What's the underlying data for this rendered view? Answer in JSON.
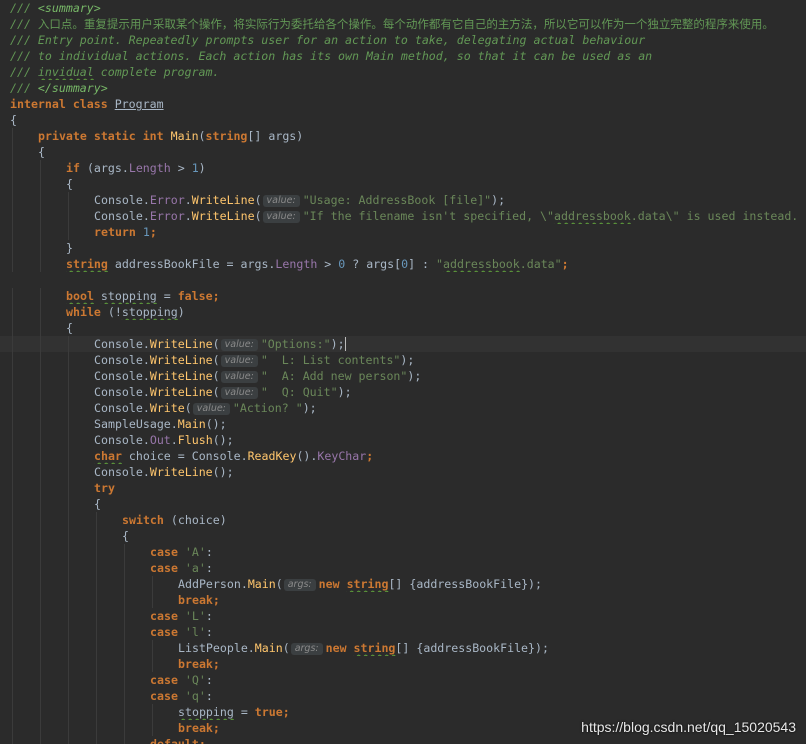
{
  "editor": {
    "lines": [
      {
        "indent": 0,
        "tokens": [
          {
            "c": "doc",
            "t": "/// "
          },
          {
            "c": "doc-tag",
            "t": "<summary>"
          }
        ]
      },
      {
        "indent": 0,
        "tokens": [
          {
            "c": "doc",
            "t": "/// "
          },
          {
            "c": "doc cjk",
            "t": "入口点。重复提示用户采取某个操作，将实际行为委托给各个操作。每个动作都有它自己的主方法，所以它可以作为一个独立完整的程序来使用。"
          }
        ]
      },
      {
        "indent": 0,
        "tokens": [
          {
            "c": "doc",
            "t": "/// Entry point. Repeatedly prompts user for an action to take, delegating actual behaviour"
          }
        ]
      },
      {
        "indent": 0,
        "tokens": [
          {
            "c": "doc",
            "t": "/// to individual actions. Each action has its own Main method, so that it can be used as an"
          }
        ]
      },
      {
        "indent": 0,
        "tokens": [
          {
            "c": "doc",
            "t": "/// "
          },
          {
            "c": "doc squig",
            "t": "invidual"
          },
          {
            "c": "doc",
            "t": " complete program."
          }
        ]
      },
      {
        "indent": 0,
        "tokens": [
          {
            "c": "doc",
            "t": "/// "
          },
          {
            "c": "doc-tag",
            "t": "</summary>"
          }
        ]
      },
      {
        "indent": 0,
        "tokens": [
          {
            "c": "kw",
            "t": "internal class "
          },
          {
            "c": "cls",
            "t": "Program"
          }
        ]
      },
      {
        "indent": 0,
        "tokens": [
          {
            "c": "p",
            "t": "{"
          }
        ]
      },
      {
        "indent": 1,
        "tokens": [
          {
            "c": "kw",
            "t": "private static int "
          },
          {
            "c": "fn",
            "t": "Main"
          },
          {
            "c": "p",
            "t": "("
          },
          {
            "c": "typ",
            "t": "string"
          },
          {
            "c": "p",
            "t": "[] args)"
          }
        ]
      },
      {
        "indent": 1,
        "tokens": [
          {
            "c": "p",
            "t": "{"
          }
        ]
      },
      {
        "indent": 2,
        "tokens": [
          {
            "c": "kw",
            "t": "if "
          },
          {
            "c": "p",
            "t": "(args."
          },
          {
            "c": "mem",
            "t": "Length"
          },
          {
            "c": "p",
            "t": " > "
          },
          {
            "c": "num",
            "t": "1"
          },
          {
            "c": "p",
            "t": ")"
          }
        ]
      },
      {
        "indent": 2,
        "tokens": [
          {
            "c": "p",
            "t": "{"
          }
        ]
      },
      {
        "indent": 3,
        "tokens": [
          {
            "c": "p",
            "t": "Console."
          },
          {
            "c": "mem",
            "t": "Error"
          },
          {
            "c": "p",
            "t": "."
          },
          {
            "c": "fn",
            "t": "WriteLine"
          },
          {
            "c": "p",
            "t": "("
          },
          {
            "c": "hint",
            "t": "value:"
          },
          {
            "c": "str",
            "t": "\"Usage: AddressBook [file]\""
          },
          {
            "c": "p",
            "t": ");"
          }
        ]
      },
      {
        "indent": 3,
        "tokens": [
          {
            "c": "p",
            "t": "Console."
          },
          {
            "c": "mem",
            "t": "Error"
          },
          {
            "c": "p",
            "t": "."
          },
          {
            "c": "fn",
            "t": "WriteLine"
          },
          {
            "c": "p",
            "t": "("
          },
          {
            "c": "hint",
            "t": "value:"
          },
          {
            "c": "str",
            "t": "\"If the filename isn't specified, \\\""
          },
          {
            "c": "str squig",
            "t": "addressbook"
          },
          {
            "c": "str",
            "t": ".data\\\" is used instead."
          }
        ]
      },
      {
        "indent": 3,
        "tokens": [
          {
            "c": "kw",
            "t": "return "
          },
          {
            "c": "num",
            "t": "1"
          },
          {
            "c": "kw",
            "t": ";"
          }
        ]
      },
      {
        "indent": 2,
        "tokens": [
          {
            "c": "p",
            "t": "}"
          }
        ]
      },
      {
        "indent": 2,
        "tokens": [
          {
            "c": "typ squig",
            "t": "string"
          },
          {
            "c": "p",
            "t": " addressBookFile = args."
          },
          {
            "c": "mem",
            "t": "Length"
          },
          {
            "c": "p",
            "t": " > "
          },
          {
            "c": "num",
            "t": "0"
          },
          {
            "c": "p",
            "t": " ? args["
          },
          {
            "c": "num",
            "t": "0"
          },
          {
            "c": "p",
            "t": "] : "
          },
          {
            "c": "str",
            "t": "\""
          },
          {
            "c": "str squig",
            "t": "addressbook"
          },
          {
            "c": "str",
            "t": ".data\""
          },
          {
            "c": "kw",
            "t": ";"
          }
        ]
      },
      {
        "indent": 0,
        "tokens": []
      },
      {
        "indent": 2,
        "tokens": [
          {
            "c": "typ squig",
            "t": "bool"
          },
          {
            "c": "p",
            "t": " "
          },
          {
            "c": "p squig",
            "t": "stopping"
          },
          {
            "c": "p",
            "t": " = "
          },
          {
            "c": "kw",
            "t": "false;"
          }
        ]
      },
      {
        "indent": 2,
        "tokens": [
          {
            "c": "kw",
            "t": "while "
          },
          {
            "c": "p",
            "t": "(!"
          },
          {
            "c": "p squig",
            "t": "stopping"
          },
          {
            "c": "p",
            "t": ")"
          }
        ]
      },
      {
        "indent": 2,
        "tokens": [
          {
            "c": "p",
            "t": "{"
          }
        ]
      },
      {
        "indent": 3,
        "current": true,
        "tokens": [
          {
            "c": "p",
            "t": "Console."
          },
          {
            "c": "fn",
            "t": "WriteLine"
          },
          {
            "c": "p",
            "t": "("
          },
          {
            "c": "hint",
            "t": "value:"
          },
          {
            "c": "str",
            "t": "\"Options:\""
          },
          {
            "c": "p",
            "t": ");"
          },
          {
            "c": "caret",
            "t": ""
          }
        ]
      },
      {
        "indent": 3,
        "tokens": [
          {
            "c": "p",
            "t": "Console."
          },
          {
            "c": "fn",
            "t": "WriteLine"
          },
          {
            "c": "p",
            "t": "("
          },
          {
            "c": "hint",
            "t": "value:"
          },
          {
            "c": "str",
            "t": "\"  L: List contents\""
          },
          {
            "c": "p",
            "t": ");"
          }
        ]
      },
      {
        "indent": 3,
        "tokens": [
          {
            "c": "p",
            "t": "Console."
          },
          {
            "c": "fn",
            "t": "WriteLine"
          },
          {
            "c": "p",
            "t": "("
          },
          {
            "c": "hint",
            "t": "value:"
          },
          {
            "c": "str",
            "t": "\"  A: Add new person\""
          },
          {
            "c": "p",
            "t": ");"
          }
        ]
      },
      {
        "indent": 3,
        "tokens": [
          {
            "c": "p",
            "t": "Console."
          },
          {
            "c": "fn",
            "t": "WriteLine"
          },
          {
            "c": "p",
            "t": "("
          },
          {
            "c": "hint",
            "t": "value:"
          },
          {
            "c": "str",
            "t": "\"  Q: Quit\""
          },
          {
            "c": "p",
            "t": ");"
          }
        ]
      },
      {
        "indent": 3,
        "tokens": [
          {
            "c": "p",
            "t": "Console."
          },
          {
            "c": "fn",
            "t": "Write"
          },
          {
            "c": "p",
            "t": "("
          },
          {
            "c": "hint",
            "t": "value:"
          },
          {
            "c": "str",
            "t": "\"Action? \""
          },
          {
            "c": "p",
            "t": ");"
          }
        ]
      },
      {
        "indent": 3,
        "tokens": [
          {
            "c": "p",
            "t": "SampleUsage."
          },
          {
            "c": "fn",
            "t": "Main"
          },
          {
            "c": "p",
            "t": "();"
          }
        ]
      },
      {
        "indent": 3,
        "tokens": [
          {
            "c": "p",
            "t": "Console."
          },
          {
            "c": "mem",
            "t": "Out"
          },
          {
            "c": "p",
            "t": "."
          },
          {
            "c": "fn",
            "t": "Flush"
          },
          {
            "c": "p",
            "t": "();"
          }
        ]
      },
      {
        "indent": 3,
        "tokens": [
          {
            "c": "typ squig",
            "t": "char"
          },
          {
            "c": "p",
            "t": " choice = Console."
          },
          {
            "c": "fn",
            "t": "ReadKey"
          },
          {
            "c": "p",
            "t": "()."
          },
          {
            "c": "mem",
            "t": "KeyChar"
          },
          {
            "c": "kw",
            "t": ";"
          }
        ]
      },
      {
        "indent": 3,
        "tokens": [
          {
            "c": "p",
            "t": "Console."
          },
          {
            "c": "fn",
            "t": "WriteLine"
          },
          {
            "c": "p",
            "t": "();"
          }
        ]
      },
      {
        "indent": 3,
        "tokens": [
          {
            "c": "kw",
            "t": "try"
          }
        ]
      },
      {
        "indent": 3,
        "tokens": [
          {
            "c": "p",
            "t": "{"
          }
        ]
      },
      {
        "indent": 4,
        "tokens": [
          {
            "c": "kw",
            "t": "switch "
          },
          {
            "c": "p",
            "t": "(choice)"
          }
        ]
      },
      {
        "indent": 4,
        "tokens": [
          {
            "c": "p",
            "t": "{"
          }
        ]
      },
      {
        "indent": 5,
        "tokens": [
          {
            "c": "kw",
            "t": "case "
          },
          {
            "c": "str",
            "t": "'A'"
          },
          {
            "c": "p",
            "t": ":"
          }
        ]
      },
      {
        "indent": 5,
        "tokens": [
          {
            "c": "kw",
            "t": "case "
          },
          {
            "c": "str",
            "t": "'a'"
          },
          {
            "c": "p",
            "t": ":"
          }
        ]
      },
      {
        "indent": 6,
        "tokens": [
          {
            "c": "p",
            "t": "AddPerson."
          },
          {
            "c": "fn",
            "t": "Main"
          },
          {
            "c": "p",
            "t": "("
          },
          {
            "c": "hint",
            "t": "args:"
          },
          {
            "c": "kw",
            "t": "new "
          },
          {
            "c": "typ squig",
            "t": "string"
          },
          {
            "c": "p",
            "t": "[] {addressBookFile});"
          }
        ]
      },
      {
        "indent": 6,
        "tokens": [
          {
            "c": "kw",
            "t": "break;"
          }
        ]
      },
      {
        "indent": 5,
        "tokens": [
          {
            "c": "kw",
            "t": "case "
          },
          {
            "c": "str",
            "t": "'L'"
          },
          {
            "c": "p",
            "t": ":"
          }
        ]
      },
      {
        "indent": 5,
        "tokens": [
          {
            "c": "kw",
            "t": "case "
          },
          {
            "c": "str",
            "t": "'l'"
          },
          {
            "c": "p",
            "t": ":"
          }
        ]
      },
      {
        "indent": 6,
        "tokens": [
          {
            "c": "p",
            "t": "ListPeople."
          },
          {
            "c": "fn",
            "t": "Main"
          },
          {
            "c": "p",
            "t": "("
          },
          {
            "c": "hint",
            "t": "args:"
          },
          {
            "c": "kw",
            "t": "new "
          },
          {
            "c": "typ squig",
            "t": "string"
          },
          {
            "c": "p",
            "t": "[] {addressBookFile});"
          }
        ]
      },
      {
        "indent": 6,
        "tokens": [
          {
            "c": "kw",
            "t": "break;"
          }
        ]
      },
      {
        "indent": 5,
        "tokens": [
          {
            "c": "kw",
            "t": "case "
          },
          {
            "c": "str",
            "t": "'Q'"
          },
          {
            "c": "p",
            "t": ":"
          }
        ]
      },
      {
        "indent": 5,
        "tokens": [
          {
            "c": "kw",
            "t": "case "
          },
          {
            "c": "str",
            "t": "'q'"
          },
          {
            "c": "p",
            "t": ":"
          }
        ]
      },
      {
        "indent": 6,
        "tokens": [
          {
            "c": "p squig",
            "t": "stopping"
          },
          {
            "c": "p",
            "t": " = "
          },
          {
            "c": "kw",
            "t": "true;"
          }
        ]
      },
      {
        "indent": 6,
        "tokens": [
          {
            "c": "kw",
            "t": "break;"
          }
        ]
      },
      {
        "indent": 5,
        "tokens": [
          {
            "c": "kw",
            "t": "default:"
          }
        ]
      }
    ]
  },
  "watermark": "https://blog.csdn.net/qq_15020543"
}
